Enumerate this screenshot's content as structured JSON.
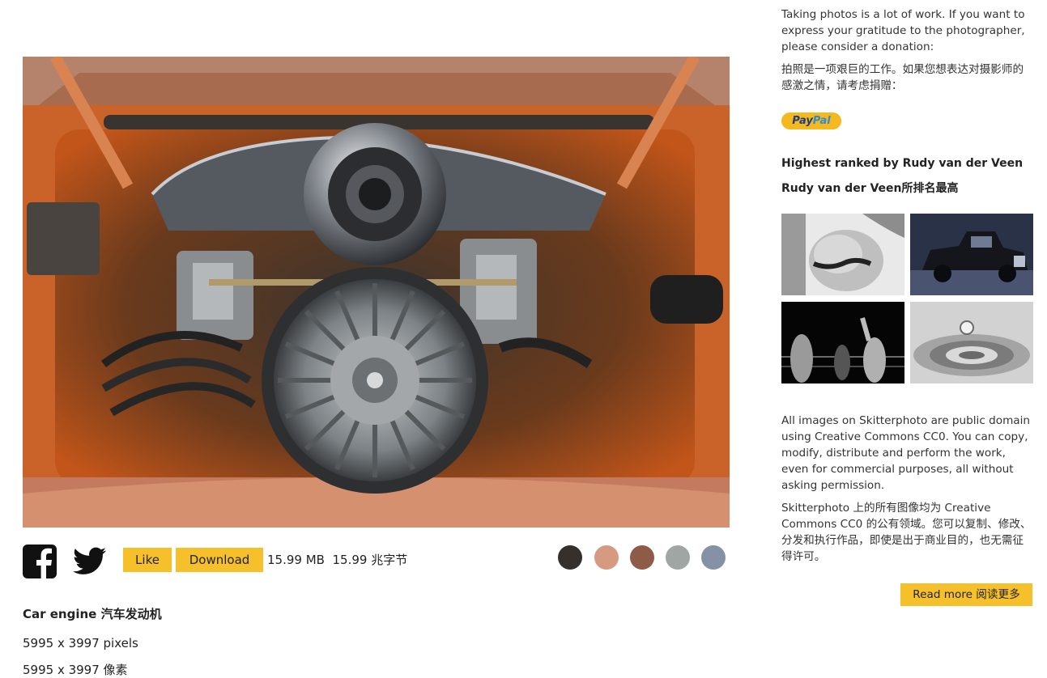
{
  "photo": {
    "title_en": "Car engine",
    "title_zh": "汽车发动机",
    "dimensions_en": "5995 x 3997 pixels",
    "dimensions_zh": "5995 x 3997 像素",
    "file_size_en": "15.99 MB",
    "file_size_zh": "15.99 兆字节"
  },
  "actions": {
    "facebook_icon": "facebook-icon",
    "twitter_icon": "twitter-icon",
    "like_label": "Like",
    "download_label": "Download"
  },
  "palette": [
    "#352f2d",
    "#d59a80",
    "#8f5b49",
    "#9fa6a3",
    "#8592a6"
  ],
  "sidebar": {
    "donate_en": "Taking photos is a lot of work. If you want to express your gratitude to the photographer, please consider a donation:",
    "donate_zh": "拍照是一项艰巨的工作。如果您想表达对摄影师的感激之情，请考虑捐赠：",
    "paypal_part1": "Pay",
    "paypal_part2": "Pal",
    "ranked_en": "Highest ranked by Rudy van der Veen",
    "ranked_zh": "Rudy van der Veen所排名最高",
    "license_en": "All images on Skitterphoto are public domain using Creative Commons CC0. You can copy, modify, distribute and perform the work, even for commercial purposes, all without asking permission.",
    "license_zh": "Skitterphoto 上的所有图像均为 Creative Commons CC0 的公有领域。您可以复制、修改、分发和执行作品，即使是出于商业目的，也无需征得许可。",
    "read_more_label": "Read more 阅读更多"
  },
  "colors": {
    "accent": "#f6c02b",
    "paypal_bg": "#f5b81f"
  }
}
